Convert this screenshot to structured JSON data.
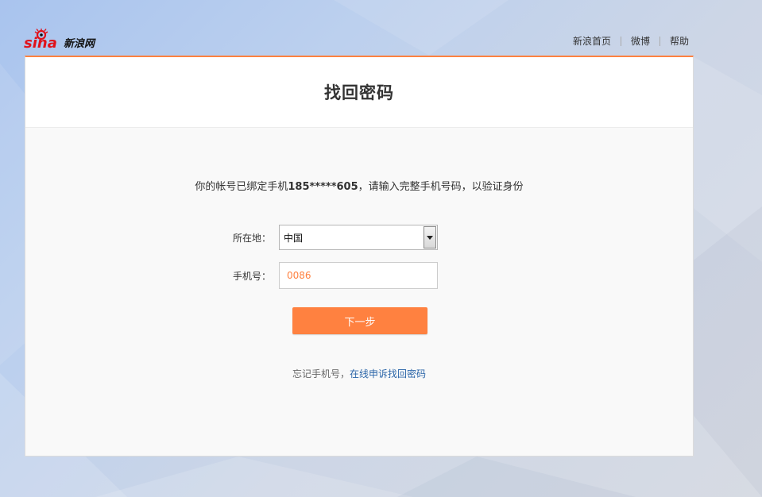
{
  "brand": {
    "logo_text": "sina",
    "logo_cn": "新浪网"
  },
  "top_nav": {
    "home": "新浪首页",
    "weibo": "微博",
    "help": "帮助"
  },
  "page_title": "找回密码",
  "notice": {
    "prefix": "你的帐号已绑定手机",
    "masked_phone": "185*****605",
    "suffix": "，请输入完整手机号码，以验证身份"
  },
  "form": {
    "location_label": "所在地：",
    "location_value": "中国",
    "phone_label": "手机号：",
    "phone_value": "0086",
    "next_button": "下一步"
  },
  "forgot": {
    "text": "忘记手机号，",
    "link": "在线申诉找回密码"
  },
  "colors": {
    "accent": "#ff8140",
    "link": "#2a65a8"
  }
}
